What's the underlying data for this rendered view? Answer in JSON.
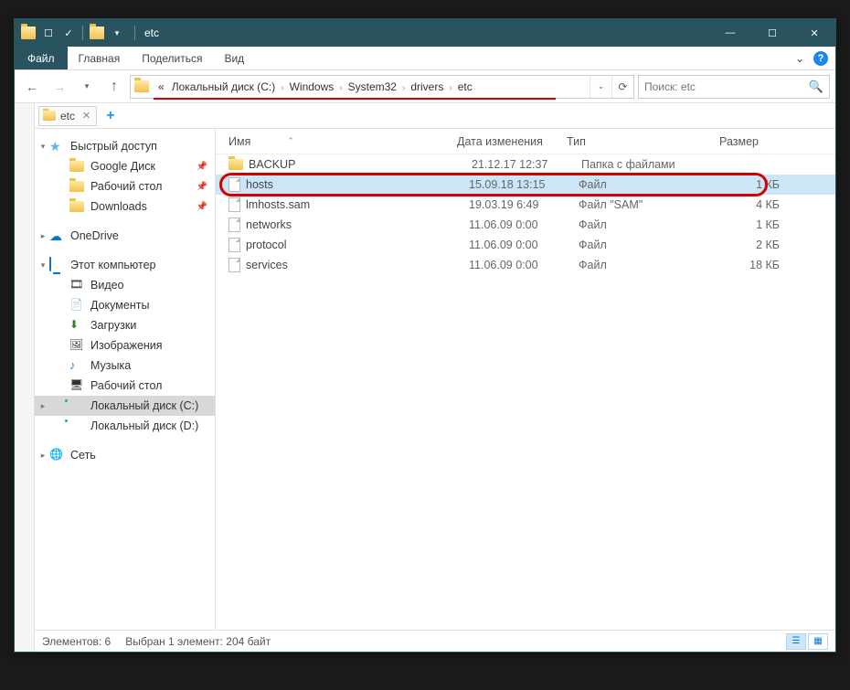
{
  "title": "etc",
  "ribbon": {
    "file": "Файл",
    "tabs": [
      "Главная",
      "Поделиться",
      "Вид"
    ]
  },
  "breadcrumb": {
    "prefix": "«",
    "items": [
      "Локальный диск (C:)",
      "Windows",
      "System32",
      "drivers",
      "etc"
    ]
  },
  "search": {
    "placeholder": "Поиск: etc"
  },
  "openTab": {
    "label": "etc"
  },
  "tree": {
    "quickAccess": "Быстрый доступ",
    "quickItems": [
      {
        "label": "Google Диск",
        "icon": "ic-fold",
        "pin": true
      },
      {
        "label": "Рабочий стол",
        "icon": "ic-fold",
        "pin": true
      },
      {
        "label": "Downloads",
        "icon": "ic-fold",
        "pin": true
      }
    ],
    "onedrive": "OneDrive",
    "thisPC": "Этот компьютер",
    "pcItems": [
      {
        "label": "Видео",
        "icon": "ic-vid"
      },
      {
        "label": "Документы",
        "icon": "ic-doc"
      },
      {
        "label": "Загрузки",
        "icon": "ic-dl"
      },
      {
        "label": "Изображения",
        "icon": "ic-img"
      },
      {
        "label": "Музыка",
        "icon": "ic-mus"
      },
      {
        "label": "Рабочий стол",
        "icon": "ic-desk"
      },
      {
        "label": "Локальный диск (C:)",
        "icon": "ic-disk",
        "selected": true
      },
      {
        "label": "Локальный диск (D:)",
        "icon": "ic-disk"
      }
    ],
    "network": "Сеть"
  },
  "columns": {
    "name": "Имя",
    "date": "Дата изменения",
    "type": "Тип",
    "size": "Размер"
  },
  "files": [
    {
      "name": "BACKUP",
      "date": "21.12.17 12:37",
      "type": "Папка с файлами",
      "size": "",
      "folder": true
    },
    {
      "name": "hosts",
      "date": "15.09.18 13:15",
      "type": "Файл",
      "size": "1 КБ",
      "selected": true
    },
    {
      "name": "lmhosts.sam",
      "date": "19.03.19 6:49",
      "type": "Файл \"SAM\"",
      "size": "4 КБ"
    },
    {
      "name": "networks",
      "date": "11.06.09 0:00",
      "type": "Файл",
      "size": "1 КБ"
    },
    {
      "name": "protocol",
      "date": "11.06.09 0:00",
      "type": "Файл",
      "size": "2 КБ"
    },
    {
      "name": "services",
      "date": "11.06.09 0:00",
      "type": "Файл",
      "size": "18 КБ"
    }
  ],
  "status": {
    "count": "Элементов: 6",
    "selection": "Выбран 1 элемент: 204 байт"
  }
}
